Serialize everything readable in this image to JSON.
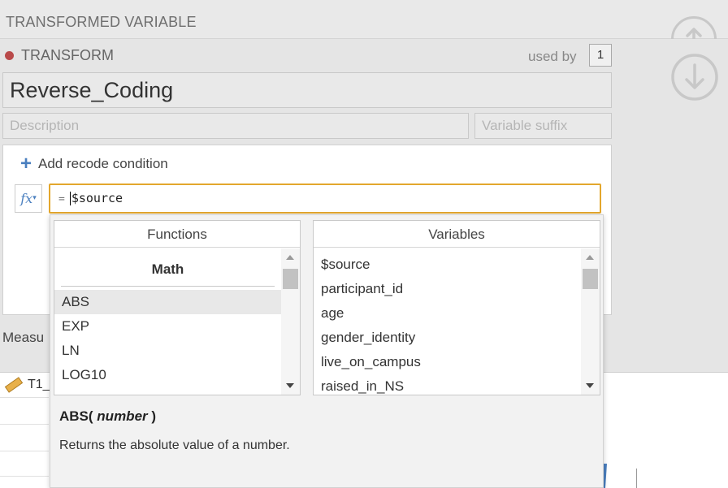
{
  "header": {
    "title": "TRANSFORMED VARIABLE"
  },
  "transform": {
    "label": "TRANSFORM",
    "used_by_label": "used by",
    "used_by_count": "1",
    "status_color": "#b94a4a",
    "name": "Reverse_Coding",
    "description_placeholder": "Description",
    "suffix_placeholder": "Variable suffix"
  },
  "recode": {
    "add_label": "Add recode condition",
    "fx_label": "fx",
    "formula_prefix": "=",
    "formula_value": "$source"
  },
  "popup": {
    "functions_header": "Functions",
    "variables_header": "Variables",
    "category": "Math",
    "functions": [
      "ABS",
      "EXP",
      "LN",
      "LOG10"
    ],
    "selected_function": "ABS",
    "variables": [
      "$source",
      "participant_id",
      "age",
      "gender_identity",
      "live_on_campus",
      "raised_in_NS"
    ],
    "signature_name": "ABS(",
    "signature_arg": "number",
    "signature_close": ")",
    "signature_description": "Returns the absolute value of a number."
  },
  "background": {
    "measure_label": "Measu",
    "row_label": "T1_"
  },
  "colors": {
    "accent": "#e3a72d",
    "icon_blue": "#4a7fbf"
  },
  "icons": [
    "move-up-icon",
    "move-down-icon",
    "plus-icon",
    "function-icon",
    "ruler-icon"
  ]
}
